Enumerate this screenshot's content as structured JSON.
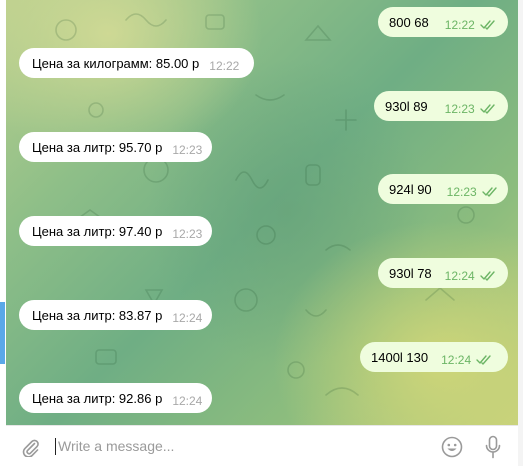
{
  "messages": [
    {
      "dir": "out",
      "text": "800 68",
      "time": "12:22",
      "read": true
    },
    {
      "dir": "in",
      "text": "Цена за килограмм: 85.00 р",
      "time": "12:22"
    },
    {
      "dir": "out",
      "text": "930l 89",
      "time": "12:23",
      "read": true
    },
    {
      "dir": "in",
      "text": "Цена за литр: 95.70 р",
      "time": "12:23"
    },
    {
      "dir": "out",
      "text": "924l 90",
      "time": "12:23",
      "read": true
    },
    {
      "dir": "in",
      "text": "Цена за литр: 97.40 р",
      "time": "12:23"
    },
    {
      "dir": "out",
      "text": "930l 78",
      "time": "12:24",
      "read": true
    },
    {
      "dir": "in",
      "text": "Цена за литр: 83.87 р",
      "time": "12:24"
    },
    {
      "dir": "out",
      "text": "1400l 130",
      "time": "12:24",
      "read": true
    },
    {
      "dir": "in",
      "text": "Цена за литр: 92.86 р",
      "time": "12:24"
    }
  ],
  "composer": {
    "placeholder": "Write a message...",
    "value": ""
  },
  "icons": {
    "attach": "paperclip-icon",
    "emoji": "smiley-icon",
    "voice": "microphone-icon",
    "read_receipt": "double-check-icon"
  },
  "colors": {
    "incoming_bubble": "#ffffff",
    "outgoing_bubble": "#effdde",
    "outgoing_time": "#6cb565",
    "incoming_time": "#a8a8a8",
    "icon_gray": "#9a9a9a"
  }
}
